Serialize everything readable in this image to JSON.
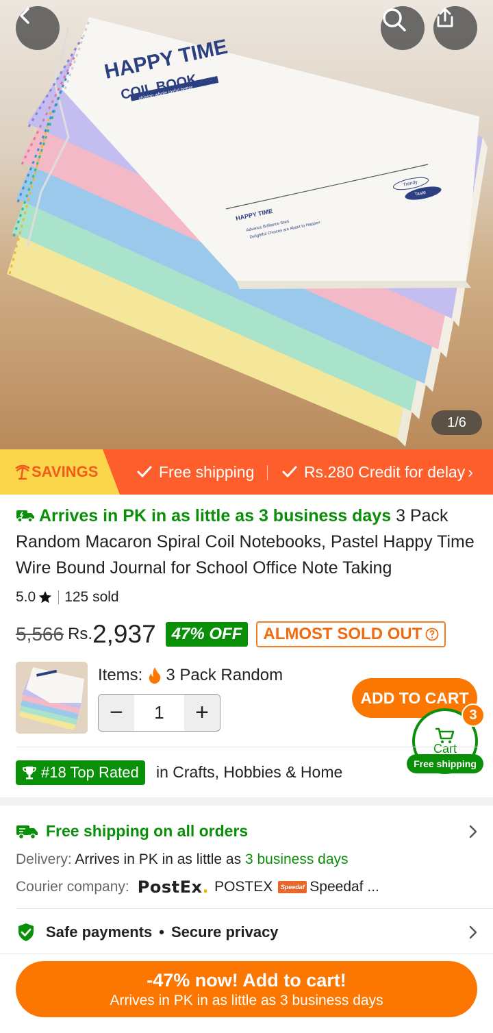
{
  "hero": {
    "pager": "1/6",
    "notebook_title": "HAPPY TIME",
    "notebook_subtitle": "COIL BOOK",
    "notebook_tagline": "shining whole joyful better",
    "notebook_footer_title": "HAPPY TIME",
    "notebook_footer_line1": "Advance Brilliance Start",
    "notebook_footer_line2": "Delightful Choices are About to Happen",
    "notebook_badge1": "Trendy",
    "notebook_badge2": "Taste"
  },
  "banner": {
    "savings_label": "SAVINGS",
    "free_shipping": "Free shipping",
    "credit": "Rs.280 Credit for delay",
    "chevron": "›"
  },
  "product": {
    "arrival": "Arrives in PK in as little as 3 business days",
    "title": " 3 Pack Random Macaron Spiral Coil Notebooks, Pastel Happy Time Wire Bound Journal for School Office Note Taking",
    "rating": "5.0",
    "sold": "125 sold",
    "old_price": "5,566",
    "currency": "Rs.",
    "price": "2,937",
    "discount": "47% OFF",
    "stock_status": "ALMOST SOLD OUT"
  },
  "selector": {
    "items_label": "Items:",
    "item_value": "3 Pack Random",
    "quantity": "1",
    "minus": "−",
    "plus": "+",
    "add_to_cart": "ADD TO CART"
  },
  "cart": {
    "label": "Cart",
    "count": "3",
    "free_shipping": "Free shipping"
  },
  "rank": {
    "badge": "#18 Top Rated",
    "category": "in Crafts, Hobbies & Home"
  },
  "shipping": {
    "title": "Free shipping on all orders",
    "delivery_label": "Delivery:",
    "delivery_text": " Arrives in PK in as little as ",
    "delivery_days": "3 business days",
    "courier_label": "Courier company:",
    "courier1_logo": "PostEx",
    "courier1_name": "POSTEX",
    "courier2_logo": "Speedaf",
    "courier2_name": "Speedaf ..."
  },
  "safety": {
    "safe_payments": "Safe payments",
    "bullet": "•",
    "secure_privacy": "Secure privacy"
  },
  "bottom": {
    "line1": "-47% now! Add to cart!",
    "line2": "Arrives in PK in as little as 3 business days"
  },
  "colors": {
    "accent_orange": "#fb7701",
    "banner_orange": "#fd5e2b",
    "green": "#0a8f08",
    "savings_yellow": "#fbd64a"
  },
  "icons": [
    "back-icon",
    "search-icon",
    "share-icon",
    "check-icon",
    "truck-icon",
    "star-icon",
    "flame-icon",
    "cart-icon",
    "trophy-icon",
    "chevron-right-icon",
    "shield-check-icon",
    "question-icon"
  ]
}
